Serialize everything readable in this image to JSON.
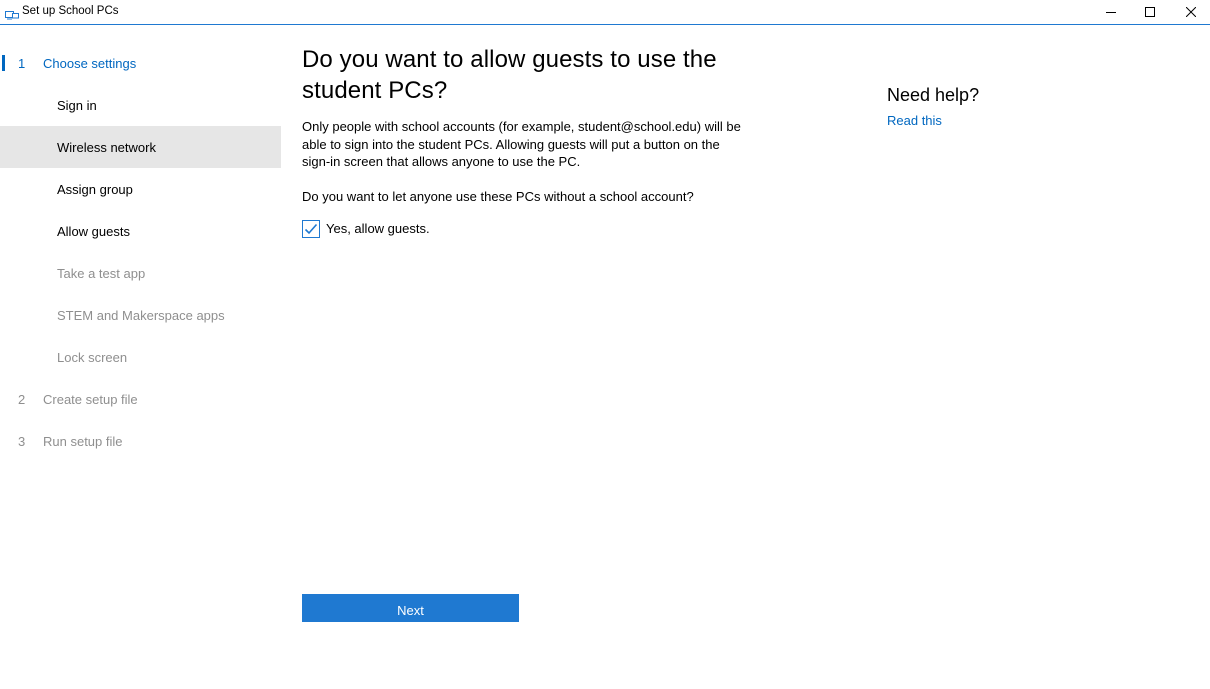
{
  "window": {
    "title": "Set up School PCs",
    "controls": {
      "minimize": "minimize-icon",
      "maximize": "maximize-icon",
      "close": "close-icon"
    }
  },
  "sidebar": {
    "steps": [
      {
        "number": "1",
        "label": "Choose settings",
        "state": "active",
        "substeps": [
          {
            "label": "Sign in",
            "state": "enabled"
          },
          {
            "label": "Wireless network",
            "state": "selected"
          },
          {
            "label": "Assign group",
            "state": "enabled"
          },
          {
            "label": "Allow guests",
            "state": "enabled"
          },
          {
            "label": "Take a test app",
            "state": "disabled"
          },
          {
            "label": "STEM and Makerspace apps",
            "state": "disabled"
          },
          {
            "label": "Lock screen",
            "state": "disabled"
          }
        ]
      },
      {
        "number": "2",
        "label": "Create setup file",
        "state": "disabled"
      },
      {
        "number": "3",
        "label": "Run setup file",
        "state": "disabled"
      }
    ]
  },
  "main": {
    "heading": "Do you want to allow guests to use the student PCs?",
    "description": "Only people with school accounts (for example, student@school.edu) will be able to sign into the student PCs. Allowing guests will put a button on the sign-in screen that allows anyone to use the PC.",
    "question": "Do you want to let anyone use these PCs without a school account?",
    "allow_guests": {
      "label": "Yes, allow guests.",
      "checked": true
    }
  },
  "footer": {
    "next_label": "Next"
  },
  "help": {
    "title": "Need help?",
    "link_label": "Read this"
  },
  "colors": {
    "accent": "#0067c0",
    "button": "#1f79d1",
    "selected_bg": "#e6e6e6",
    "disabled_text": "#8f8f8f"
  }
}
